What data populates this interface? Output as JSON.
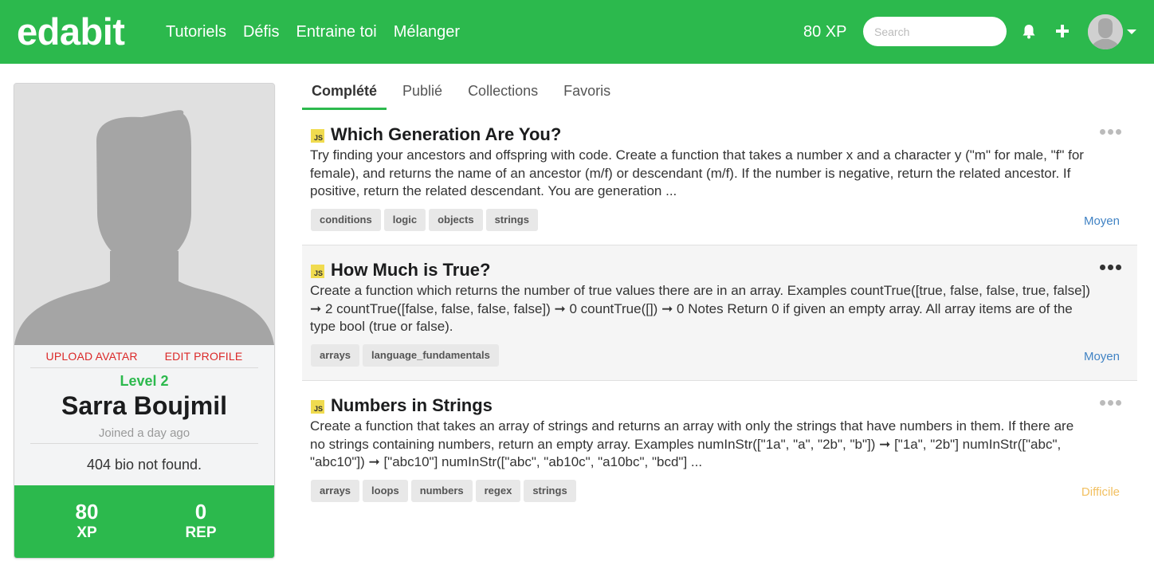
{
  "navbar": {
    "brand": "edabit",
    "links": [
      "Tutoriels",
      "Défis",
      "Entraine toi",
      "Mélanger"
    ],
    "xp": "80 XP",
    "search_placeholder": "Search",
    "icons": [
      "bell-icon",
      "plus-icon",
      "user-avatar",
      "chevron-down-icon"
    ]
  },
  "profile": {
    "upload_avatar": "UPLOAD AVATAR",
    "edit_profile": "EDIT PROFILE",
    "level": "Level 2",
    "name": "Sarra Boujmil",
    "joined": "Joined a day ago",
    "bio": "404 bio not found.",
    "stats": [
      {
        "value": "80",
        "label": "XP"
      },
      {
        "value": "0",
        "label": "REP"
      }
    ]
  },
  "tabs": [
    {
      "label": "Complété",
      "active": true
    },
    {
      "label": "Publié",
      "active": false
    },
    {
      "label": "Collections",
      "active": false
    },
    {
      "label": "Favoris",
      "active": false
    }
  ],
  "challenges": [
    {
      "language": "JS",
      "title": "Which Generation Are You?",
      "description": "Try finding your ancestors and offspring with code. Create a function that takes a number x and a character y (\"m\" for male, \"f\" for female), and returns the name of an ancestor (m/f) or descendant (m/f). If the number is negative, return the related ancestor. If positive, return the related descendant. You are generation ...",
      "tags": [
        "conditions",
        "logic",
        "objects",
        "strings"
      ],
      "difficulty": "Moyen"
    },
    {
      "language": "JS",
      "title": "How Much is True?",
      "description": "Create a function which returns the number of true values there are in an array. Examples countTrue([true, false, false, true, false]) ➞ 2 countTrue([false, false, false, false]) ➞ 0 countTrue([]) ➞ 0 Notes Return 0 if given an empty array. All array items are of the type bool (true or false).",
      "tags": [
        "arrays",
        "language_fundamentals"
      ],
      "difficulty": "Moyen"
    },
    {
      "language": "JS",
      "title": "Numbers in Strings",
      "description": "Create a function that takes an array of strings and returns an array with only the strings that have numbers in them. If there are no strings containing numbers, return an empty array. Examples numInStr([\"1a\", \"a\", \"2b\", \"b\"]) ➞ [\"1a\", \"2b\"] numInStr([\"abc\", \"abc10\"]) ➞ [\"abc10\"] numInStr([\"abc\", \"ab10c\", \"a10bc\", \"bcd\"] ...",
      "tags": [
        "arrays",
        "loops",
        "numbers",
        "regex",
        "strings"
      ],
      "difficulty": "Difficile"
    }
  ],
  "colors": {
    "brand_green": "#2cb94d",
    "moyen": "#4183c4",
    "difficile": "#f2c061",
    "link_red": "#db2828"
  }
}
